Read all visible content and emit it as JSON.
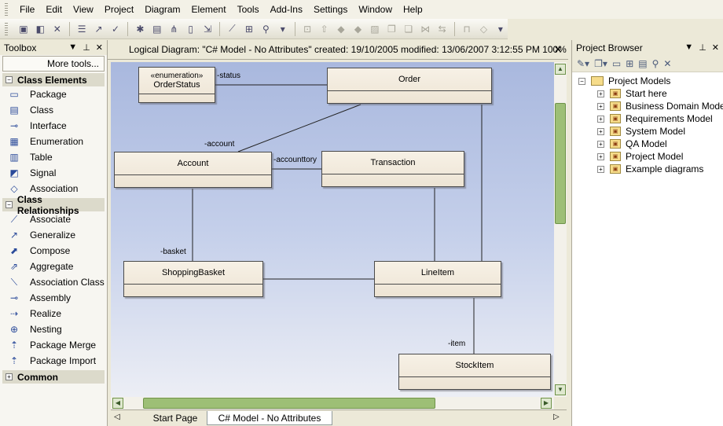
{
  "menu": [
    "File",
    "Edit",
    "View",
    "Project",
    "Diagram",
    "Element",
    "Tools",
    "Add-Ins",
    "Settings",
    "Window",
    "Help"
  ],
  "toolbox": {
    "title": "Toolbox",
    "more_tools": "More tools...",
    "class_elements": {
      "title": "Class Elements",
      "items": [
        {
          "label": "Package",
          "icon": "package-icon"
        },
        {
          "label": "Class",
          "icon": "class-icon"
        },
        {
          "label": "Interface",
          "icon": "interface-icon"
        },
        {
          "label": "Enumeration",
          "icon": "enumeration-icon"
        },
        {
          "label": "Table",
          "icon": "table-icon"
        },
        {
          "label": "Signal",
          "icon": "signal-icon"
        },
        {
          "label": "Association",
          "icon": "association-icon"
        }
      ]
    },
    "class_relationships": {
      "title": "Class Relationships",
      "items": [
        {
          "label": "Associate",
          "icon": "associate-icon"
        },
        {
          "label": "Generalize",
          "icon": "generalize-icon"
        },
        {
          "label": "Compose",
          "icon": "compose-icon"
        },
        {
          "label": "Aggregate",
          "icon": "aggregate-icon"
        },
        {
          "label": "Association Class",
          "icon": "association-class-icon"
        },
        {
          "label": "Assembly",
          "icon": "assembly-icon"
        },
        {
          "label": "Realize",
          "icon": "realize-icon"
        },
        {
          "label": "Nesting",
          "icon": "nesting-icon"
        },
        {
          "label": "Package Merge",
          "icon": "package-merge-icon"
        },
        {
          "label": "Package Import",
          "icon": "package-import-icon"
        }
      ]
    },
    "common": {
      "title": "Common"
    }
  },
  "diagram": {
    "header": "Logical Diagram: \"C# Model - No Attributes\"   created: 19/10/2005  modified: 13/06/2007 3:12:55 PM    100%    7",
    "classes": {
      "orderstatus": {
        "stereotype": "«enumeration»",
        "name": "OrderStatus"
      },
      "order": {
        "name": "Order"
      },
      "account": {
        "name": "Account"
      },
      "transaction": {
        "name": "Transaction"
      },
      "shoppingbasket": {
        "name": "ShoppingBasket"
      },
      "lineitem": {
        "name": "LineItem"
      },
      "stockitem": {
        "name": "StockItem"
      }
    },
    "roles": {
      "status": "-status",
      "account": "-account",
      "accounttory": "-accounttory",
      "basket": "-basket",
      "item": "-item"
    }
  },
  "tabs": {
    "start": "Start Page",
    "active": "C# Model - No Attributes"
  },
  "browser": {
    "title": "Project Browser",
    "root": "Project Models",
    "children": [
      "Start here",
      "Business Domain Model",
      "Requirements Model",
      "System Model",
      "QA Model",
      "Project Model",
      "Example diagrams"
    ]
  }
}
